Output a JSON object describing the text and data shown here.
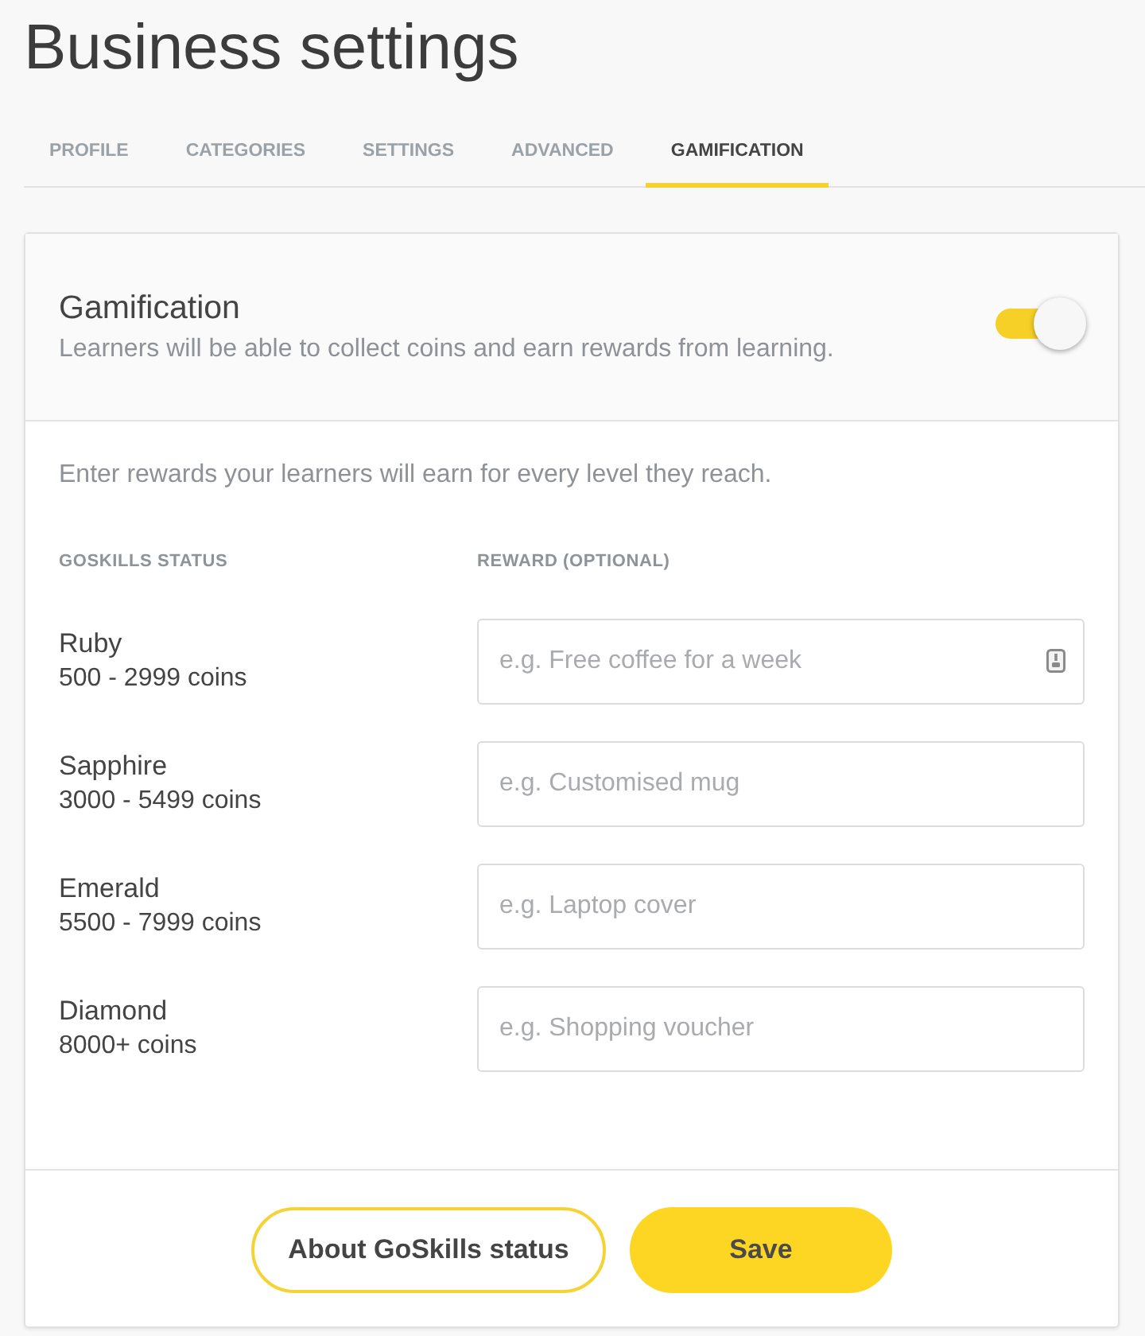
{
  "page": {
    "title": "Business settings"
  },
  "tabs": [
    {
      "label": "PROFILE",
      "selected": false
    },
    {
      "label": "CATEGORIES",
      "selected": false
    },
    {
      "label": "SETTINGS",
      "selected": false
    },
    {
      "label": "ADVANCED",
      "selected": false
    },
    {
      "label": "GAMIFICATION",
      "selected": true
    }
  ],
  "gamification": {
    "title": "Gamification",
    "description": "Learners will be able to collect coins and earn rewards from learning.",
    "on": true
  },
  "rewards": {
    "intro": "Enter rewards your learners will earn for every level they reach.",
    "columns": [
      "GOSKILLS STATUS",
      "REWARD (OPTIONAL)"
    ],
    "rows": [
      {
        "status": "Ruby",
        "range": "500 - 2999 coins",
        "placeholder": "e.g. Free coffee for a week",
        "field_icon": true
      },
      {
        "status": "Sapphire",
        "range": "3000 - 5499 coins",
        "placeholder": "e.g. Customised mug",
        "field_icon": false
      },
      {
        "status": "Emerald",
        "range": "5500 - 7999 coins",
        "placeholder": "e.g. Laptop cover",
        "field_icon": false
      },
      {
        "status": "Diamond",
        "range": "8000+ coins",
        "placeholder": "e.g. Shopping voucher",
        "field_icon": false
      }
    ]
  },
  "buttons": [
    {
      "label": "About GoSkills status",
      "kind": "outline"
    },
    {
      "label": "Save",
      "kind": "primary"
    }
  ]
}
